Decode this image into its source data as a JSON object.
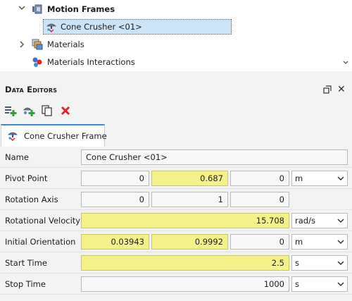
{
  "tree": {
    "items": [
      {
        "label": "Motion Frames",
        "icon": "motion-frames-icon",
        "expanded": true
      },
      {
        "label": "Cone Crusher <01>",
        "icon": "motion-frame-icon",
        "selected": true
      },
      {
        "label": "Materials",
        "icon": "materials-icon",
        "expanded": false
      },
      {
        "label": "Materials Interactions",
        "icon": "materials-interactions-icon"
      }
    ]
  },
  "data_editors": {
    "title": "Data Editors",
    "toolbar": {
      "icons": [
        "add-frame-icon",
        "add-child-frame-icon",
        "copy-icon",
        "delete-icon"
      ]
    },
    "tab": {
      "label": "Cone Crusher Frame",
      "icon": "motion-frame-icon"
    },
    "rows": [
      {
        "label": "Name",
        "name_value": "Cone Crusher <01>"
      },
      {
        "label": "Pivot Point",
        "values": [
          "0",
          "0.687",
          "0"
        ],
        "unit": "m"
      },
      {
        "label": "Rotation Axis",
        "values": [
          "0",
          "1",
          "0"
        ]
      },
      {
        "label": "Rotational Velocity",
        "value": "15.708",
        "unit": "rad/s"
      },
      {
        "label": "Initial Orientation",
        "values": [
          "0.03943",
          "0.9992",
          "0"
        ],
        "unit": "m"
      },
      {
        "label": "Start Time",
        "value": "2.5",
        "unit": "s"
      },
      {
        "label": "Stop Time",
        "value": "1000",
        "unit": "s"
      }
    ]
  },
  "colors": {
    "highlight_field": "#f6f28a",
    "selection": "#cce4f7",
    "tab_accent": "#3a8fd6",
    "delete": "#e0242b"
  }
}
